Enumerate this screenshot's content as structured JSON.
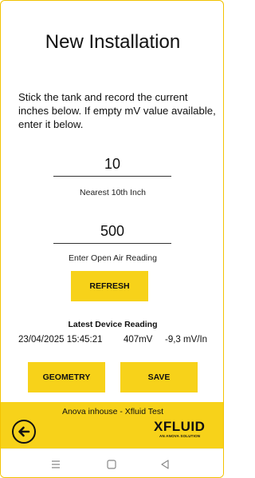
{
  "screen": {
    "title": "New Installation",
    "instructions": "Stick the tank and record the current inches below. If empty mV value available, enter it below."
  },
  "inches_field": {
    "value": "10",
    "label": "Nearest 10th Inch"
  },
  "air_field": {
    "value": "500",
    "label": "Enter Open Air Reading"
  },
  "buttons": {
    "refresh": "REFRESH",
    "geometry": "GEOMETRY",
    "save": "SAVE"
  },
  "latest_reading": {
    "title": "Latest Device Reading",
    "timestamp": "23/04/2025 15:45:21",
    "millivolts": "407mV",
    "rate": "-9,3 mV/In"
  },
  "footer": {
    "caption": "Anova inhouse - Xfluid Test",
    "logo_name": "XFLUID",
    "logo_tagline": "AN ANOVA SOLUTION",
    "back_icon": "arrow-left-circle-icon"
  },
  "navbar": {
    "icons": [
      "recents-icon",
      "home-icon",
      "back-triangle-icon"
    ]
  },
  "colors": {
    "accent": "#f7d21a",
    "border": "#f2c200",
    "text": "#111111"
  }
}
